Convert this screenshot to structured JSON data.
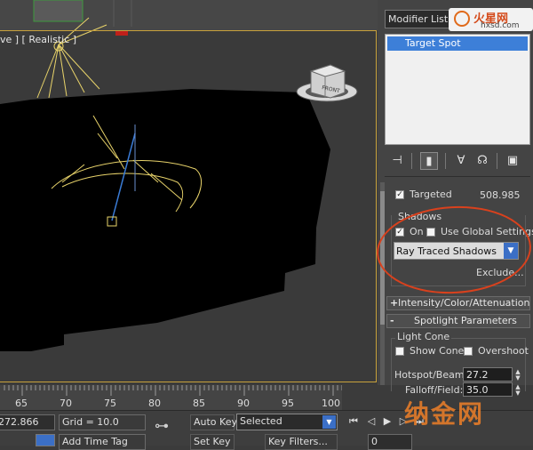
{
  "viewport": {
    "label": "ve ] [ Realistic ]",
    "viewcube_face": "FRONT"
  },
  "command_panel": {
    "modifier_list": "Modifier List",
    "watermark_main": "火星网",
    "watermark_sub": "hxsd.com",
    "stack_item": "Target Spot",
    "tools": [
      "pin-stack-icon",
      "show-end-result-icon",
      "make-unique-icon",
      "remove-modifier-icon",
      "configure-sets-icon"
    ]
  },
  "general": {
    "targeted_label": "Targeted",
    "targeted_checked": true,
    "targeted_value": "508.985"
  },
  "shadows": {
    "group_title": "Shadows",
    "on_label": "On",
    "on_checked": true,
    "global_label": "Use Global Settings",
    "global_checked": false,
    "type_value": "Ray Traced Shadows",
    "exclude_label": "Exclude..."
  },
  "rollouts": {
    "intensity": {
      "sign": "+",
      "label": "Intensity/Color/Attenuation"
    },
    "spotlight": {
      "sign": "-",
      "label": "Spotlight Parameters"
    }
  },
  "light_cone": {
    "title": "Light Cone",
    "show_cone_label": "Show Cone",
    "overshoot_label": "Overshoot",
    "hotspot_label": "Hotspot/Beam:",
    "hotspot_value": "27.2",
    "falloff_label": "Falloff/Field:",
    "falloff_value": "35.0"
  },
  "timeline": {
    "ticks": [
      "65",
      "70",
      "75",
      "80",
      "85",
      "90",
      "95",
      "100"
    ]
  },
  "statusbar": {
    "coord_value": "272.866",
    "grid_label": "Grid = 10.0",
    "auto_key": "Auto Key",
    "set_key": "Set Key",
    "selected_value": "Selected",
    "key_filters": "Key Filters...",
    "add_time_tag": "Add Time Tag",
    "frame_value": "0"
  },
  "watermark_bottom": "纳金网",
  "colors": {
    "annotation": "#d9411d",
    "selection": "#3d7fd8",
    "wireframe": "#e8d36a",
    "target_line": "#3a7bd5"
  }
}
